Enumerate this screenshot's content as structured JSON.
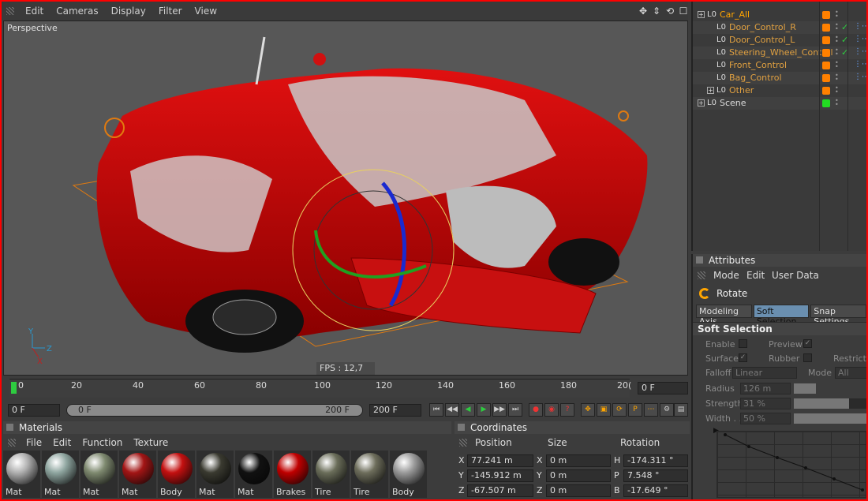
{
  "viewport": {
    "menu": [
      "Edit",
      "Cameras",
      "Display",
      "Filter",
      "View"
    ],
    "label": "Perspective",
    "fps": "FPS : 12,7"
  },
  "timeline": {
    "ticks": [
      "0",
      "20",
      "40",
      "60",
      "80",
      "100",
      "120",
      "140",
      "160",
      "180",
      "20("
    ],
    "current_frame": "0 F",
    "start": "0 F",
    "range_start": "0 F",
    "range_end": "200 F",
    "end": "200 F"
  },
  "materials": {
    "title": "Materials",
    "menu": [
      "File",
      "Edit",
      "Function",
      "Texture"
    ],
    "items": [
      {
        "name": "Mat",
        "color": "#b0b0b0"
      },
      {
        "name": "Mat",
        "color": "#8fa6a0"
      },
      {
        "name": "Mat",
        "color": "#7f8a70"
      },
      {
        "name": "Mat",
        "color": "#a31515"
      },
      {
        "name": "Body",
        "color": "#c41010"
      },
      {
        "name": "Mat",
        "color": "#3a3a30"
      },
      {
        "name": "Mat",
        "color": "#111111"
      },
      {
        "name": "Brakes",
        "color": "#c00000"
      },
      {
        "name": "Tire",
        "color": "#6b6e5a"
      },
      {
        "name": "Tire",
        "color": "#6e6e5c"
      },
      {
        "name": "Body",
        "color": "#9a9a9a"
      }
    ]
  },
  "coordinates": {
    "title": "Coordinates",
    "headers": {
      "position": "Position",
      "size": "Size",
      "rotation": "Rotation"
    },
    "rows": [
      {
        "axis": "X",
        "pos": "77.241 m",
        "saxis": "X",
        "size": "0 m",
        "raxis": "H",
        "rot": "-174.311 °"
      },
      {
        "axis": "Y",
        "pos": "-145.912 m",
        "saxis": "Y",
        "size": "0 m",
        "raxis": "P",
        "rot": "7.548 °"
      },
      {
        "axis": "Z",
        "pos": "-67.507 m",
        "saxis": "Z",
        "size": "0 m",
        "raxis": "B",
        "rot": "-17.649 °"
      }
    ]
  },
  "objects": [
    {
      "name": "Car_All",
      "color": "#ffa500",
      "tag": "#ff8000",
      "indent": 0
    },
    {
      "name": "Door_Control_R",
      "color": "#e0a040",
      "tag": "#ff8000",
      "indent": 1
    },
    {
      "name": "Door_Control_L",
      "color": "#e0a040",
      "tag": "#ff8000",
      "indent": 1
    },
    {
      "name": "Steering_Wheel_Control",
      "color": "#e0a040",
      "tag": "#ff8000",
      "indent": 1
    },
    {
      "name": "Front_Control",
      "color": "#e0a040",
      "tag": "#ff8000",
      "indent": 1
    },
    {
      "name": "Bag_Control",
      "color": "#e0a040",
      "tag": "#ff8000",
      "indent": 1
    },
    {
      "name": "Other",
      "color": "#e0a040",
      "tag": "#ff8000",
      "indent": 1
    },
    {
      "name": "Scene",
      "color": "#dddddd",
      "tag": "#22dd22",
      "indent": 0
    }
  ],
  "attributes": {
    "title": "Attributes",
    "menu": [
      "Mode",
      "Edit",
      "User Data"
    ],
    "tool": "Rotate",
    "tabs": [
      "Modeling Axis",
      "Soft Selection",
      "Snap Settings"
    ],
    "section": "Soft Selection",
    "enable": "Enable",
    "preview": "Preview",
    "surface": "Surface",
    "rubber": "Rubber",
    "restrict": "Restrict",
    "falloff": "Falloff",
    "falloff_value": "Linear",
    "mode": "Mode",
    "mode_value": "All",
    "radius": "Radius",
    "radius_value": "126 m",
    "strength": "Strength",
    "strength_value": "31 %",
    "strength_level": 0.31,
    "width": "Width . .",
    "width_value": "50 %",
    "width_level": 0.5
  }
}
